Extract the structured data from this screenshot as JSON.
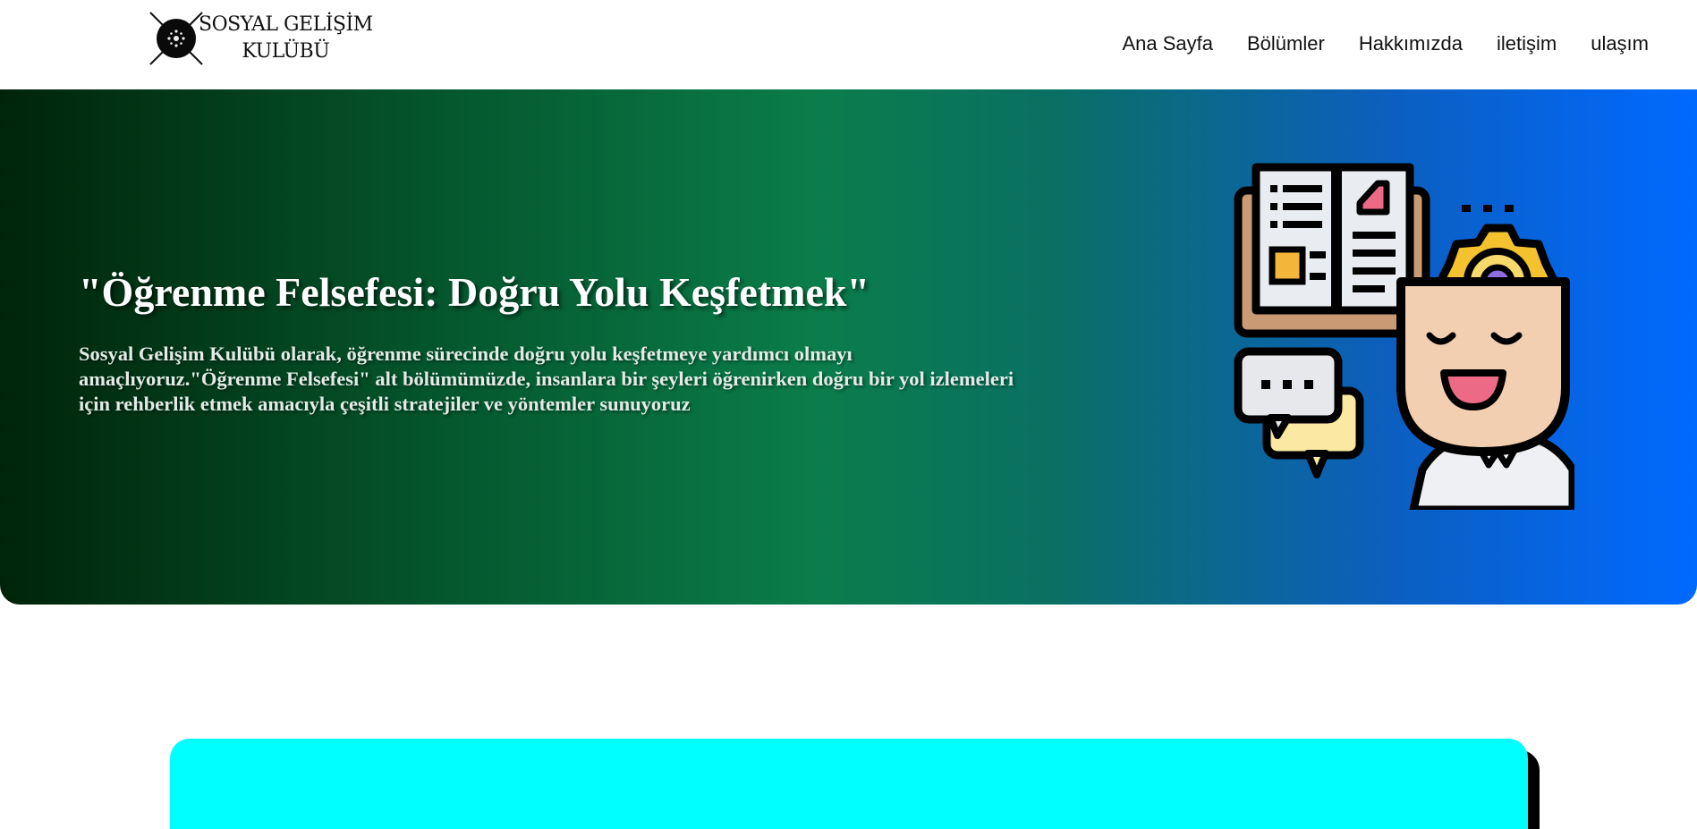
{
  "header": {
    "logo_text_line1": "SOSYAL GELİŞİM",
    "logo_text_line2": "KULÜBÜ",
    "nav": [
      {
        "label": "Ana Sayfa"
      },
      {
        "label": "Bölümler"
      },
      {
        "label": "Hakkımızda"
      },
      {
        "label": "iletişim"
      },
      {
        "label": "ulaşım"
      }
    ]
  },
  "hero": {
    "title": "\"Öğrenme Felsefesi: Doğru Yolu Keşfetmek\"",
    "paragraph": "Sosyal Gelişim Kulübü olarak, öğrenme sürecinde doğru yolu keşfetmeye yardımcı olmayı amaçlıyoruz.\"Öğrenme Felsefesi\" alt bölümümüzde, insanlara bir şeyleri öğrenirken doğru bir yol izlemeleri için rehberlik etmek amacıyla çeşitli stratejiler ve yöntemler sunuyoruz",
    "illustration_icon": "learning-mind-icon",
    "gradient_colors": [
      "#002409",
      "#0b7d4a",
      "#0069ff"
    ]
  },
  "card": {
    "color": "#00ffff"
  }
}
